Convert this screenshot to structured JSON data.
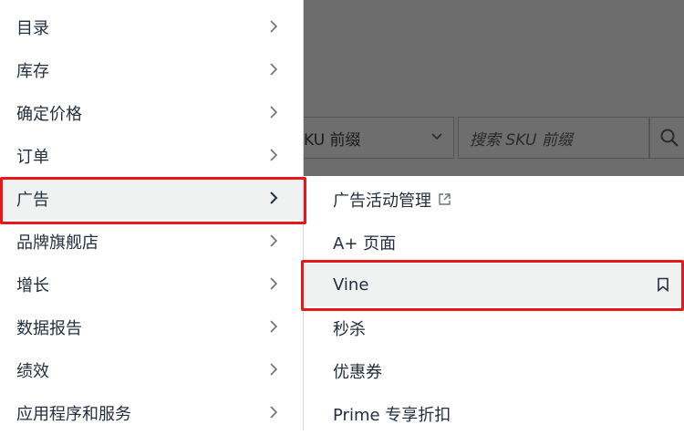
{
  "background": {
    "sku_select_value": "KU 前缀",
    "sku_search_placeholder": "搜索 SKU 前缀"
  },
  "main_menu": {
    "items": [
      {
        "label": "目录"
      },
      {
        "label": "库存"
      },
      {
        "label": "确定价格"
      },
      {
        "label": "订单"
      },
      {
        "label": "广告"
      },
      {
        "label": "品牌旗舰店"
      },
      {
        "label": "增长"
      },
      {
        "label": "数据报告"
      },
      {
        "label": "绩效"
      },
      {
        "label": "应用程序和服务"
      }
    ],
    "active_item": "广告"
  },
  "sub_menu": {
    "items": [
      {
        "label": "广告活动管理"
      },
      {
        "label": "A+ 页面"
      },
      {
        "label": "Vine"
      },
      {
        "label": "秒杀"
      },
      {
        "label": "优惠券"
      },
      {
        "label": "Prime 专享折扣"
      }
    ],
    "active_item": "Vine"
  },
  "colors": {
    "highlight": "#e3191b",
    "text": "#232f3e",
    "overlay": "#6c6c6c",
    "active_row": "#f0f2f2"
  }
}
